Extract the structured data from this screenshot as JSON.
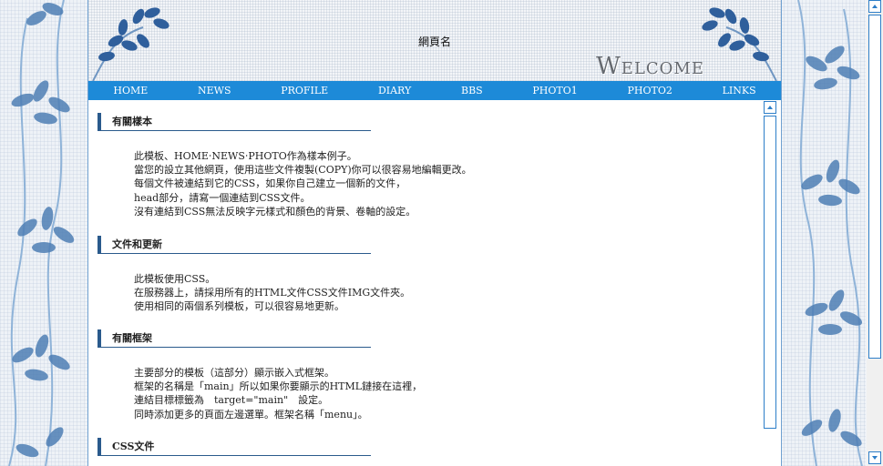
{
  "header": {
    "site_title": "網頁名",
    "welcome": "Welcome"
  },
  "nav": {
    "items": [
      "HOME",
      "NEWS",
      "PROFILE",
      "DIARY",
      "BBS",
      "PHOTO1",
      "PHOTO2",
      "LINKS"
    ]
  },
  "sections": [
    {
      "title": "有關樣本",
      "lines": [
        "此模板、HOME‧NEWS‧PHOTO作為樣本例子。",
        "當您的設立其他網頁，使用這些文件複製(COPY)你可以很容易地編輯更改。",
        "每個文件被連結到它的CSS，如果你自己建立一個新的文件，",
        "head部分，請寫一個連結到CSS文件。",
        "沒有連結到CSS無法反映字元樣式和顏色的背景、卷軸的設定。"
      ]
    },
    {
      "title": "文件和更新",
      "lines": [
        "此模板使用CSS。",
        "在服務器上，請採用所有的HTML文件CSS文件IMG文件夾。",
        "使用相同的兩個系列模板，可以很容易地更新。"
      ]
    },
    {
      "title": "有關框架",
      "lines": [
        "主要部分的模板（這部分）顯示嵌入式框架。",
        "框架的名稱是「main」所以如果你要顯示的HTML鏈接在這裡，",
        "連結目標標籤為　target=\"main\"　設定。",
        "同時添加更多的頁面左邊選單。框架名稱「menu」。"
      ]
    },
    {
      "title": "CSS文件",
      "lines": []
    }
  ]
}
